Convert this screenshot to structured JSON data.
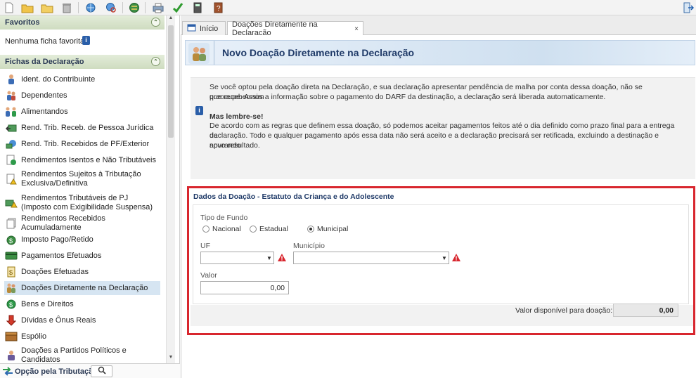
{
  "toolbar": {
    "icons": [
      "new-file-icon",
      "open-folder-icon",
      "folder-icon",
      "trash-icon",
      "refresh-globe-icon",
      "globe-search-icon",
      "transmit-icon",
      "print-icon",
      "check-icon",
      "calculator-icon",
      "help-book-icon",
      "exit-icon"
    ]
  },
  "sidebar": {
    "favoritos_title": "Favoritos",
    "favoritos_empty": "Nenhuma ficha favorita",
    "fichas_title": "Fichas da Declaração",
    "items": [
      {
        "label": "Ident. do Contribuinte",
        "icon": "person-icon"
      },
      {
        "label": "Dependentes",
        "icon": "people-icon"
      },
      {
        "label": "Alimentandos",
        "icon": "family-icon"
      },
      {
        "label": "Rend. Trib. Receb. de Pessoa Jurídica",
        "icon": "money-arrow-icon"
      },
      {
        "label": "Rend. Trib. Recebidos de PF/Exterior",
        "icon": "globe-money-icon"
      },
      {
        "label": "Rendimentos Isentos e Não Tributáveis",
        "icon": "document-check-icon"
      },
      {
        "label": "Rendimentos Sujeitos à Tributação Exclusiva/Definitiva",
        "icon": "document-warning-icon"
      },
      {
        "label": "Rendimentos Tributáveis de PJ (Imposto com Exigibilidade Suspensa)",
        "icon": "money-warning-icon"
      },
      {
        "label": "Rendimentos Recebidos Acumuladamente",
        "icon": "document-stack-icon"
      },
      {
        "label": "Imposto Pago/Retido",
        "icon": "money-bag-icon"
      },
      {
        "label": "Pagamentos Efetuados",
        "icon": "card-icon"
      },
      {
        "label": "Doações Efetuadas",
        "icon": "coins-icon"
      },
      {
        "label": "Doações Diretamente na Declaração",
        "icon": "people-icon"
      },
      {
        "label": "Bens e Direitos",
        "icon": "coin-stack-icon"
      },
      {
        "label": "Dívidas e Ônus Reais",
        "icon": "down-arrow-icon"
      },
      {
        "label": "Espólio",
        "icon": "chest-icon"
      },
      {
        "label": "Doações a Partidos Políticos e Candidatos",
        "icon": "ballot-icon"
      }
    ],
    "selected_index": 12,
    "opcao_label": "Opção pela Tributação:"
  },
  "tabs": [
    {
      "label": "Início",
      "icon": "home-icon"
    },
    {
      "label": "Doações Diretamente na Declaração",
      "close": "×"
    }
  ],
  "banner": {
    "title": "Novo Doação Diretamente na Declaração"
  },
  "info": {
    "paragraph1_line1": "Se você optou pela doação direta na Declaração, e sua declaração apresentar pendência de malha por conta dessa doação, não se preocupe. Assim",
    "paragraph1_line2": "que recebermos a informação sobre o pagamento do DARF da destinação, a declaração será liberada automaticamente.",
    "heading": "Mas lembre-se!",
    "paragraph2_line1": "De acordo com as regras que definem essa doação, só podemos aceitar pagamentos feitos até o dia definido como prazo final para a entrega da",
    "paragraph2_line2": "declaração. Todo e qualquer pagamento após essa data não será aceito e a declaração precisará ser retificada, excluindo a destinação e apurando",
    "paragraph2_line3": "novo resultado."
  },
  "form": {
    "title": "Dados da Doação - Estatuto da Criança e do Adolescente",
    "tipo_fundo_label": "Tipo de Fundo",
    "radios": [
      "Nacional",
      "Estadual",
      "Municipal"
    ],
    "radio_selected": "Municipal",
    "uf_label": "UF",
    "uf_value": "",
    "municipio_label": "Município",
    "municipio_value": "",
    "valor_label": "Valor",
    "valor_value": "0,00",
    "disponivel_label": "Valor disponível para doação:",
    "disponivel_value": "0,00"
  },
  "colors": {
    "highlight_frame": "#d8262e",
    "selected_item": "#d6e5f2",
    "banner_title": "#1f3a68"
  }
}
